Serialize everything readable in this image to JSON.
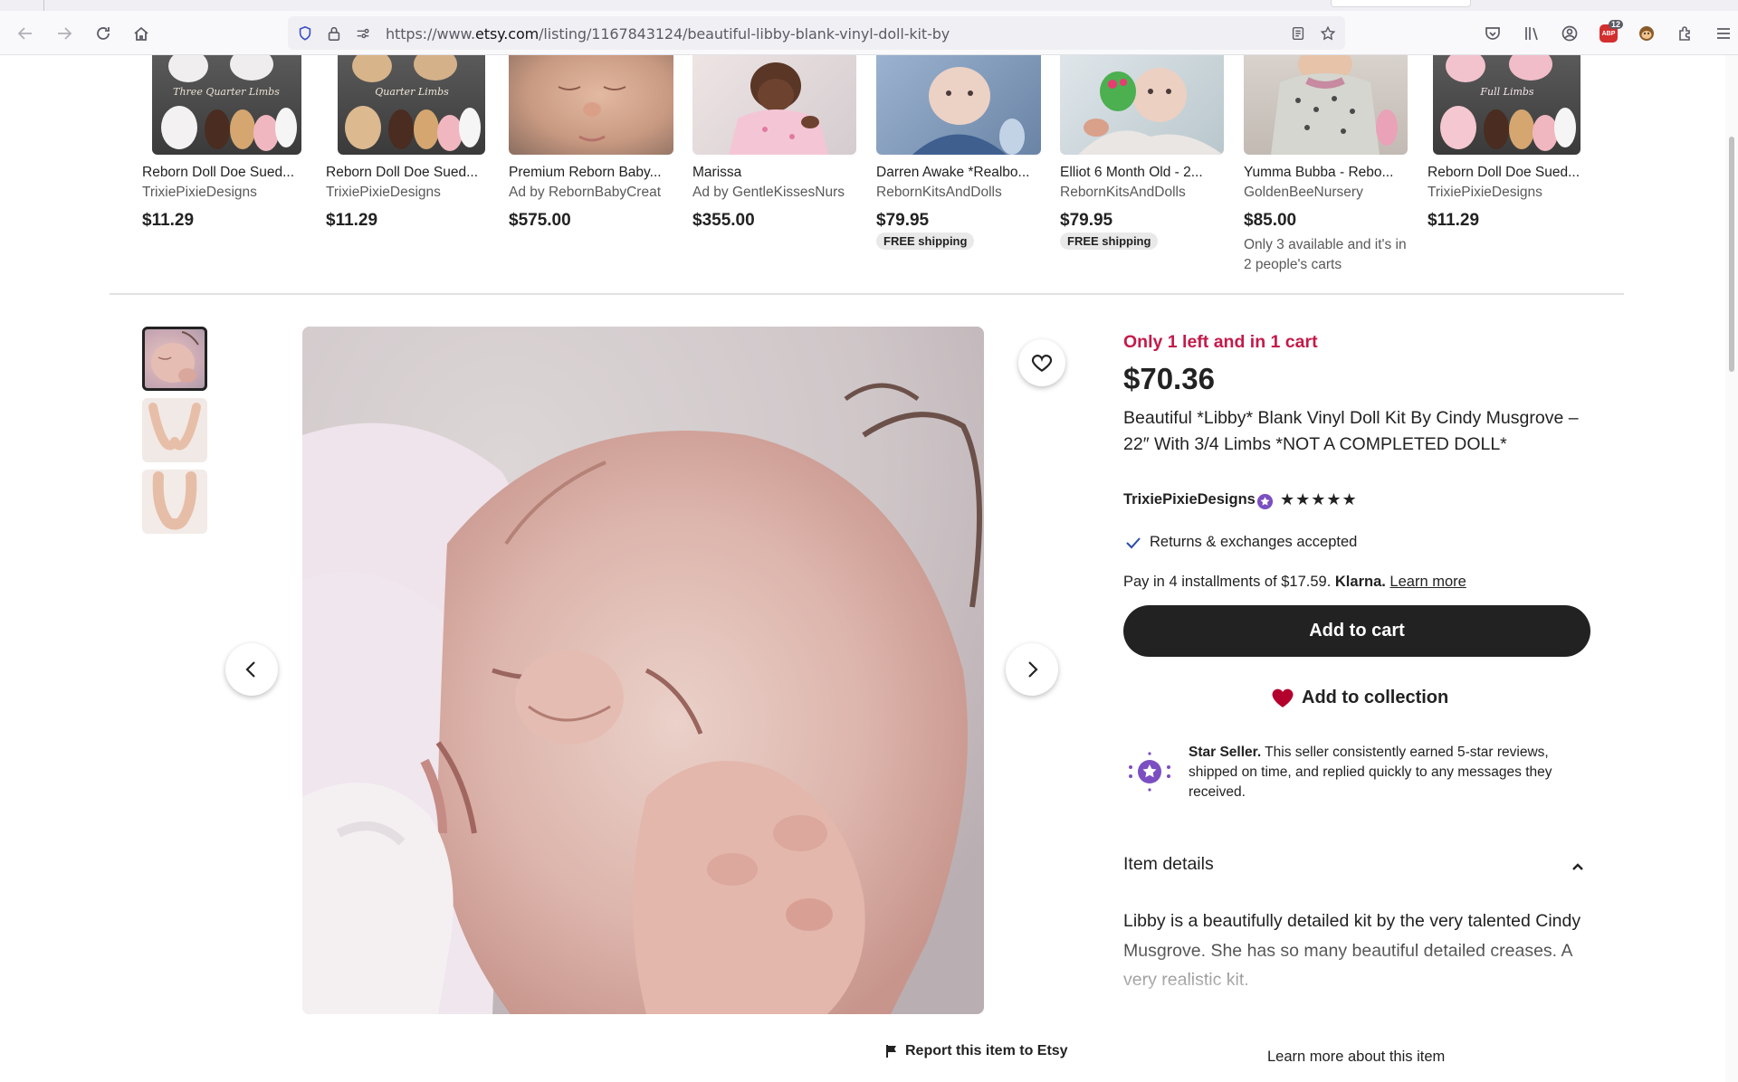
{
  "browser": {
    "url_prefix": "https://www.",
    "url_domain": "etsy.com",
    "url_path": "/listing/1167843124/beautiful-libby-blank-vinyl-doll-kit-by",
    "ext_badge_count": "12",
    "ext_badge_label": "ABP"
  },
  "related": [
    {
      "title": "Reborn Doll Doe Sued...",
      "shop": "TrixiePixieDesigns",
      "price": "$11.29",
      "image_text": "Three Quarter Limbs"
    },
    {
      "title": "Reborn Doll Doe Sued...",
      "shop": "TrixiePixieDesigns",
      "price": "$11.29",
      "image_text": "Quarter Limbs"
    },
    {
      "title": "Premium Reborn Baby...",
      "shop": "Ad by RebornBabyCreat",
      "price": "$575.00"
    },
    {
      "title": "Marissa",
      "shop": "Ad by GentleKissesNurs",
      "price": "$355.00"
    },
    {
      "title": "Darren Awake *Realbo...",
      "shop": "RebornKitsAndDolls",
      "price": "$79.95",
      "badge": "FREE shipping"
    },
    {
      "title": "Elliot 6 Month Old - 2...",
      "shop": "RebornKitsAndDolls",
      "price": "$79.95",
      "badge": "FREE shipping"
    },
    {
      "title": "Yumma Bubba - Rebo...",
      "shop": "GoldenBeeNursery",
      "price": "$85.00",
      "availability": "Only 3 available and it's in 2 people's carts"
    },
    {
      "title": "Reborn Doll Doe Sued...",
      "shop": "TrixiePixieDesigns",
      "price": "$11.29",
      "image_text": "Full Limbs"
    }
  ],
  "listing": {
    "stock": "Only 1 left and in 1 cart",
    "price": "$70.36",
    "title": "Beautiful *Libby* Blank Vinyl Doll Kit By Cindy Musgrove – 22″ With 3/4 Limbs *NOT A COMPLETED DOLL*",
    "seller": "TrixiePixieDesigns",
    "stars": "★★★★★",
    "returns": "Returns & exchanges accepted",
    "klarna_prefix": "Pay in 4 installments of $17.59. ",
    "klarna_brand": "Klarna.",
    "klarna_link": "Learn more",
    "add_to_cart": "Add to cart",
    "add_to_collection": "Add to collection",
    "star_seller_bold": "Star Seller.",
    "star_seller_text": " This seller consistently earned 5-star reviews, shipped on time, and replied quickly to any messages they received.",
    "details_heading": "Item details",
    "details_body": "Libby is a beautifully detailed kit by the very talented Cindy Musgrove. She has so many beautiful detailed creases. A very realistic kit.",
    "learn_more_item": "Learn more about this item",
    "report": "Report this item to Etsy"
  },
  "colors": {
    "accent_red": "#c41a4a",
    "star_seller_purple": "#7b4fc1",
    "heart_red": "#b3002d"
  }
}
